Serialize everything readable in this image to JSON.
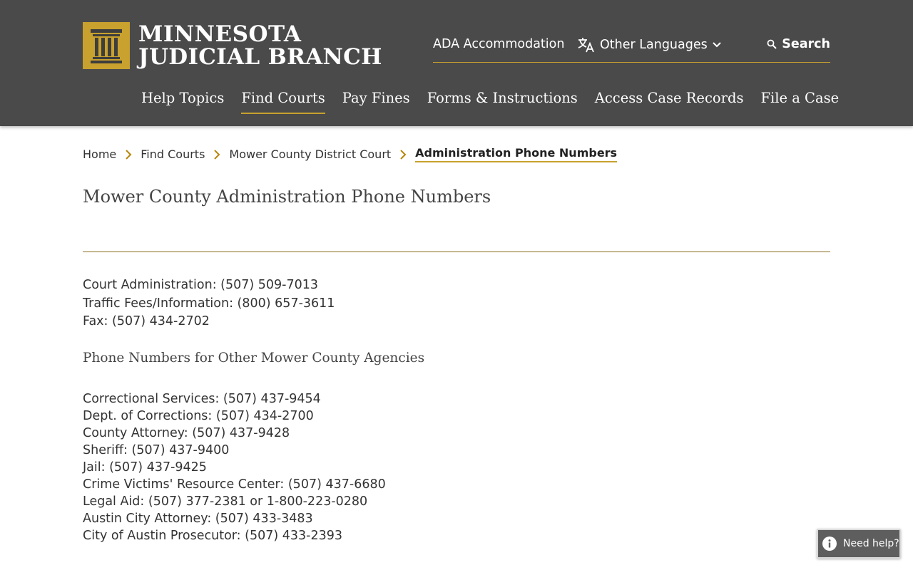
{
  "logo": {
    "line1": "MINNESOTA",
    "line2": "JUDICIAL BRANCH"
  },
  "utility": {
    "ada": "ADA Accommodation",
    "languages": "Other Languages",
    "search": "Search"
  },
  "nav": {
    "items": [
      {
        "label": "Help Topics"
      },
      {
        "label": "Find Courts",
        "active": true
      },
      {
        "label": "Pay Fines"
      },
      {
        "label": "Forms & Instructions"
      },
      {
        "label": "Access Case Records"
      },
      {
        "label": "File a Case"
      }
    ]
  },
  "breadcrumb": {
    "items": [
      "Home",
      "Find Courts",
      "Mower County District Court"
    ],
    "current": "Administration Phone Numbers"
  },
  "page": {
    "title": "Mower County Administration Phone Numbers",
    "main_numbers": [
      "Court Administration: (507) 509-7013",
      "Traffic Fees/Information: (800) 657-3611",
      "Fax: (507) 434-2702"
    ],
    "subhead": "Phone Numbers for Other Mower County Agencies",
    "agency_numbers": [
      "Correctional Services: (507) 437-9454",
      "Dept. of Corrections: (507) 434-2700",
      "County Attorney: (507) 437-9428",
      "Sheriff: (507) 437-9400",
      "Jail: (507) 437-9425",
      "Crime Victims' Resource Center: (507) 437-6680",
      "Legal Aid: (507) 377-2381 or 1-800-223-0280",
      "Austin City Attorney: (507) 433-3483",
      "City of Austin Prosecutor: (507) 433-2393"
    ]
  },
  "help": {
    "label": "Need help?"
  },
  "colors": {
    "header_bg": "#4a4a4a",
    "accent_gold": "#c8a12e",
    "text": "#333333"
  }
}
